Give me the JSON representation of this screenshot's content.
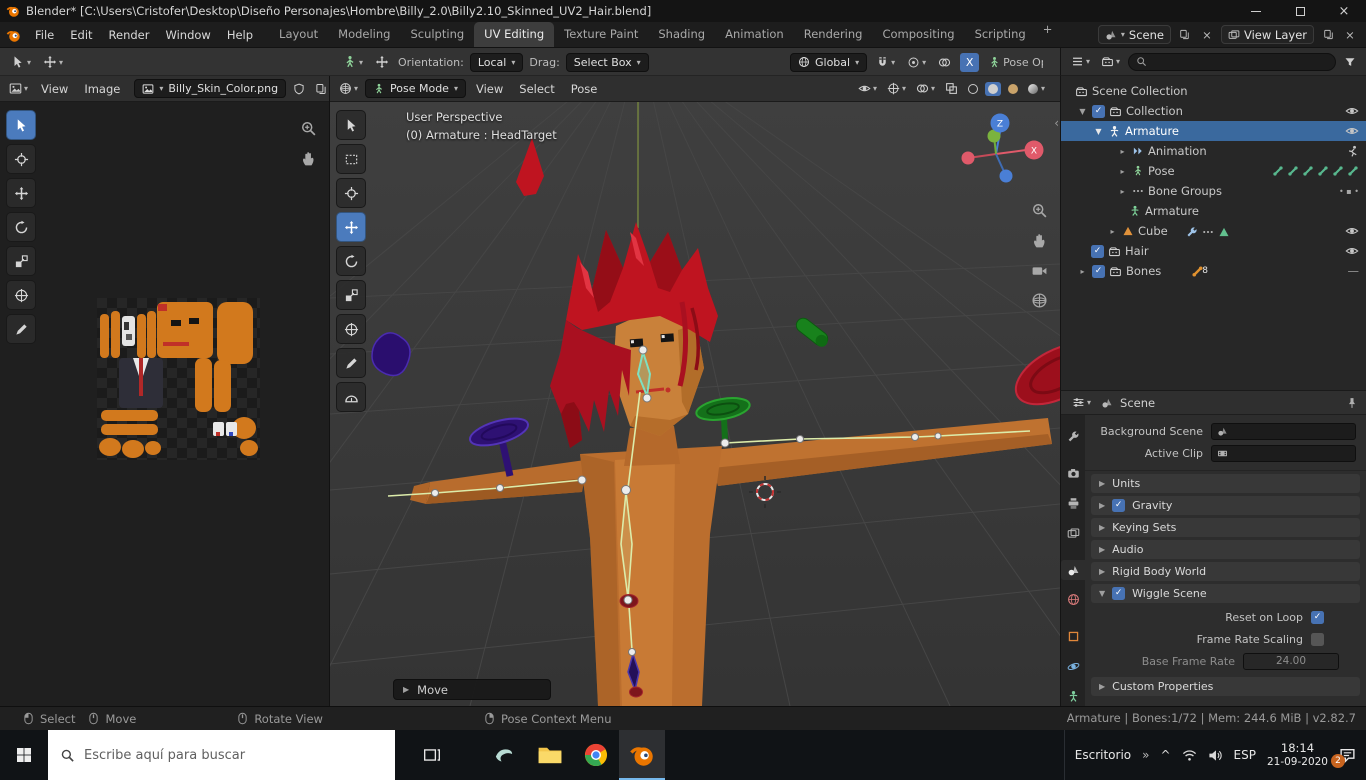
{
  "icons": {
    "chevron_down": "▾",
    "tri_right": "▸",
    "tri_down": "▼",
    "tri_right_big": "▶",
    "close": "×",
    "plus": "+",
    "check": "✓",
    "collapse_left": "‹",
    "overflow": "»",
    "caret_up": "^",
    "dash": "—",
    "dots": "• ▪ •"
  },
  "title_bar": {
    "title": "Blender* [C:\\Users\\Cristofer\\Desktop\\Diseño Personajes\\Hombre\\Billy_2.0\\Billy2.10_Skinned_UV2_Hair.blend]"
  },
  "topbar": {
    "menus": [
      "File",
      "Edit",
      "Render",
      "Window",
      "Help"
    ],
    "tabs": [
      "Layout",
      "Modeling",
      "Sculpting",
      "UV Editing",
      "Texture Paint",
      "Shading",
      "Animation",
      "Rendering",
      "Compositing",
      "Scripting"
    ],
    "scene_value": "Scene",
    "view_layer_value": "View Layer"
  },
  "tool_settings": {
    "orientation_label": "Orientation:",
    "orientation_value": "Local",
    "drag_label": "Drag:",
    "drag_value": "Select Box",
    "transform_orientation": "Global",
    "mirror_x": "X",
    "pose_options": "Pose Op"
  },
  "uv_editor": {
    "menus": [
      "View",
      "Image"
    ],
    "image_name": "Billy_Skin_Color.png"
  },
  "viewport": {
    "mode": "Pose Mode",
    "menus": [
      "View",
      "Select",
      "Pose"
    ],
    "overlay_title": "User Perspective",
    "overlay_subtitle": "(0) Armature : HeadTarget",
    "operator_label": "Move",
    "axis_z": "Z",
    "axis_x": "X"
  },
  "outliner": {
    "items": [
      {
        "label": "Scene Collection"
      },
      {
        "label": "Collection"
      },
      {
        "label": "Armature"
      },
      {
        "label": "Animation"
      },
      {
        "label": "Pose"
      },
      {
        "label": "Bone Groups"
      },
      {
        "label": "Armature"
      },
      {
        "label": "Cube"
      },
      {
        "label": "Hair"
      },
      {
        "label": "Bones",
        "badge": "8"
      }
    ]
  },
  "properties": {
    "breadcrumb": "Scene",
    "background_scene_label": "Background Scene",
    "active_clip_label": "Active Clip",
    "sections": {
      "units": "Units",
      "gravity": "Gravity",
      "keying_sets": "Keying Sets",
      "audio": "Audio",
      "rigid_body_world": "Rigid Body World",
      "wiggle_scene": "Wiggle Scene",
      "custom_properties": "Custom Properties"
    },
    "wiggle": {
      "reset_on_loop": "Reset on Loop",
      "frame_rate_scaling": "Frame Rate Scaling",
      "base_frame_rate": "Base Frame Rate",
      "base_frame_rate_value": "24.00"
    }
  },
  "status_bar": {
    "hints": [
      "Select",
      "Move",
      "Rotate View",
      "Pose Context Menu"
    ],
    "info": "Armature  |  Bones:1/72  |  Mem: 244.6 MiB  |  v2.82.7"
  },
  "taskbar": {
    "search_placeholder": "Escribe aquí para buscar",
    "desktop_label": "Escritorio",
    "language": "ESP",
    "time": "18:14",
    "date": "21-09-2020",
    "badge": "2"
  }
}
